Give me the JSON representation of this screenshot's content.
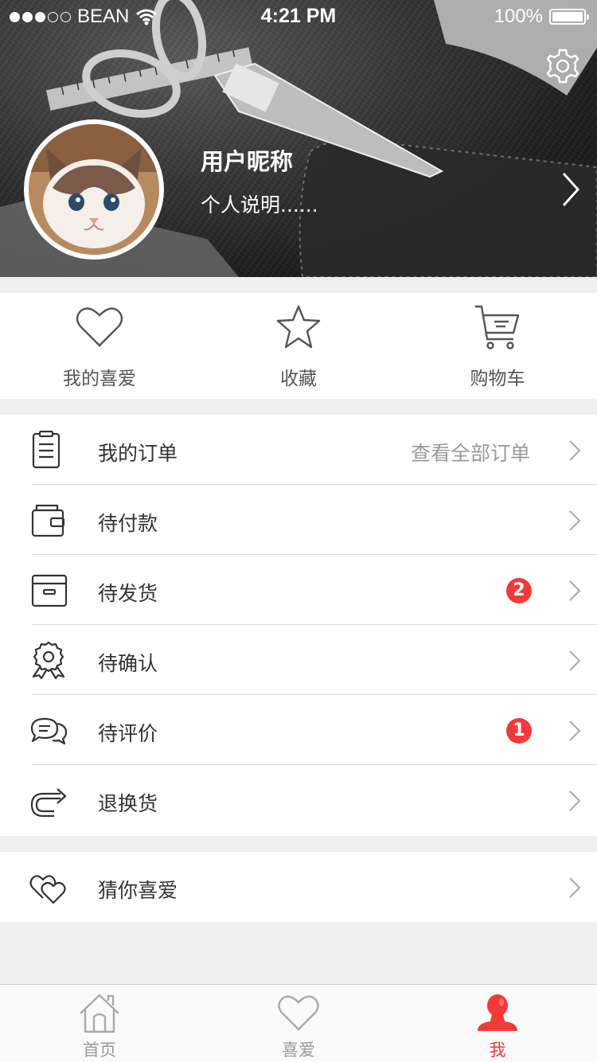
{
  "status_bar": {
    "carrier": "BEAN",
    "time": "4:21 PM",
    "battery": "100%",
    "signal_bars_filled": 3,
    "signal_bars_total": 5
  },
  "profile": {
    "nickname": "用户昵称",
    "bio": "个人说明......"
  },
  "quick_actions": [
    {
      "label": "我的喜爱",
      "icon": "heart-icon"
    },
    {
      "label": "收藏",
      "icon": "star-icon"
    },
    {
      "label": "购物车",
      "icon": "cart-icon"
    }
  ],
  "orders": {
    "title": "我的订单",
    "view_all": "查看全部订单",
    "items": [
      {
        "label": "待付款",
        "icon": "wallet-icon",
        "badge": ""
      },
      {
        "label": "待发货",
        "icon": "box-icon",
        "badge": "2"
      },
      {
        "label": "待确认",
        "icon": "ribbon-icon",
        "badge": ""
      },
      {
        "label": "待评价",
        "icon": "chat-icon",
        "badge": "1"
      },
      {
        "label": "退换货",
        "icon": "return-icon",
        "badge": ""
      }
    ]
  },
  "guess": {
    "label": "猜你喜爱",
    "icon": "double-heart-icon"
  },
  "tabbar": [
    {
      "label": "首页",
      "icon": "home-icon",
      "active": false
    },
    {
      "label": "喜爱",
      "icon": "heart-icon",
      "active": false
    },
    {
      "label": "我",
      "icon": "user-icon",
      "active": true
    }
  ],
  "colors": {
    "accent": "#f23a3a",
    "text": "#333333",
    "muted": "#999999",
    "background": "#efefef"
  }
}
